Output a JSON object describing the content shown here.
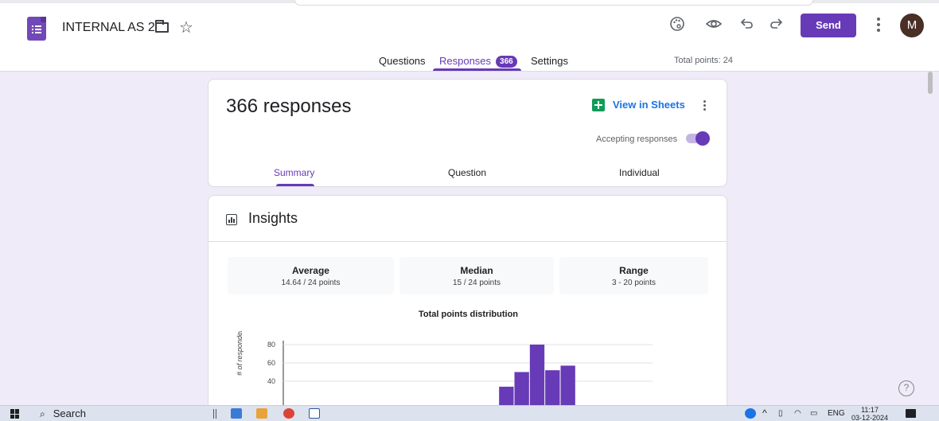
{
  "header": {
    "doc_title": "INTERNAL AS 2",
    "send_label": "Send",
    "avatar_letter": "M"
  },
  "tabs": {
    "questions": "Questions",
    "responses": "Responses",
    "responses_count": "366",
    "settings": "Settings",
    "total_points": "Total points: 24"
  },
  "summary_card": {
    "count_label": "366 responses",
    "view_sheets": "View in Sheets",
    "accepting_label": "Accepting responses",
    "accepting": true,
    "subtabs": [
      "Summary",
      "Question",
      "Individual"
    ]
  },
  "insights": {
    "title": "Insights",
    "stats": [
      {
        "label": "Average",
        "value": "14.64 / 24 points"
      },
      {
        "label": "Median",
        "value": "15 / 24 points"
      },
      {
        "label": "Range",
        "value": "3 - 20 points"
      }
    ]
  },
  "chart_data": {
    "type": "bar",
    "title": "Total points distribution",
    "ylabel": "# of respondents",
    "yticks": [
      40,
      60,
      80
    ],
    "ylim": [
      0,
      85
    ],
    "xlim": [
      0,
      24
    ],
    "bars": [
      {
        "x": 14,
        "value": 34
      },
      {
        "x": 15,
        "value": 50
      },
      {
        "x": 16,
        "value": 80
      },
      {
        "x": 17,
        "value": 52
      },
      {
        "x": 18,
        "value": 57
      }
    ],
    "bar_color": "#673ab7"
  },
  "taskbar": {
    "search_label": "Search",
    "lang": "ENG",
    "time": "11:17",
    "date": "03-12-2024"
  }
}
